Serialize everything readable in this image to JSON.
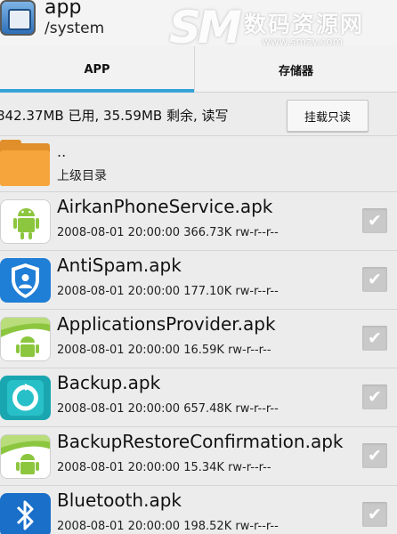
{
  "header": {
    "title": "app",
    "path": "/system"
  },
  "watermark": {
    "logo": "SM",
    "text": "数码资源网",
    "url": "www.smzy.com"
  },
  "tabs": [
    {
      "label": "APP",
      "active": true
    },
    {
      "label": "存储器",
      "active": false
    }
  ],
  "storage": {
    "info": "842.37MB 已用, 35.59MB 剩余, 读写",
    "mount_button": "挂载只读"
  },
  "parent": {
    "dots": "..",
    "label": "上级目录"
  },
  "files": [
    {
      "name": "AirkanPhoneService.apk",
      "meta": "2008-08-01 20:00:00  366.73K  rw-r--r--",
      "icon": "android-icon",
      "checked": true
    },
    {
      "name": "AntiSpam.apk",
      "meta": "2008-08-01 20:00:00  177.10K  rw-r--r--",
      "icon": "shield-icon",
      "checked": true
    },
    {
      "name": "ApplicationsProvider.apk",
      "meta": "2008-08-01 20:00:00  16.59K  rw-r--r--",
      "icon": "android-provider-icon",
      "checked": true
    },
    {
      "name": "Backup.apk",
      "meta": "2008-08-01 20:00:00  657.48K  rw-r--r--",
      "icon": "backup-icon",
      "checked": true
    },
    {
      "name": "BackupRestoreConfirmation.apk",
      "meta": "2008-08-01 20:00:00  15.34K  rw-r--r--",
      "icon": "android-provider-icon",
      "checked": true
    },
    {
      "name": "Bluetooth.apk",
      "meta": "2008-08-01 20:00:00  198.52K  rw-r--r--",
      "icon": "bluetooth-icon",
      "checked": true
    }
  ],
  "colors": {
    "tab_indicator": "#36a2d8",
    "checkbox": "#c9c9c9"
  },
  "check_glyph": "✔"
}
